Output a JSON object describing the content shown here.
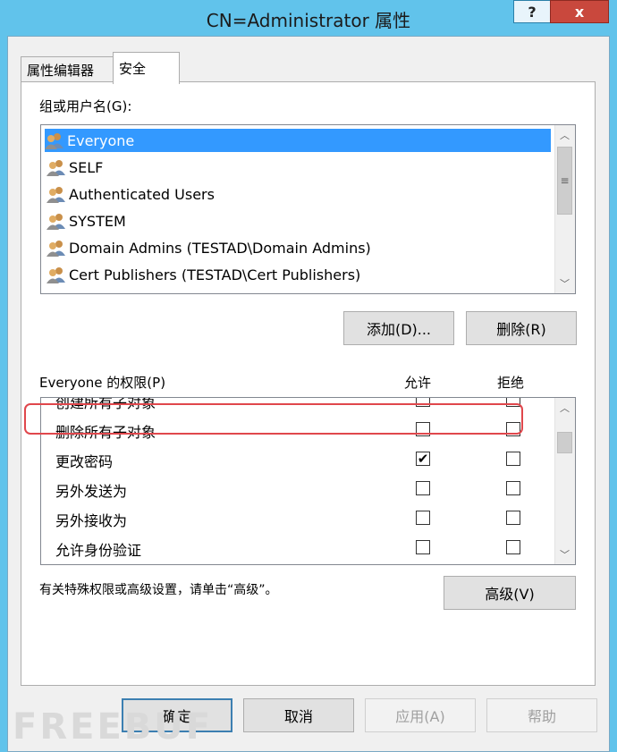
{
  "window": {
    "title": "CN=Administrator 属性",
    "help_label": "?",
    "close_label": "x"
  },
  "tabs": [
    {
      "label": "属性编辑器"
    },
    {
      "label": "安全"
    }
  ],
  "groups": {
    "label": "组或用户名(G):",
    "items": [
      {
        "label": "Everyone",
        "selected": true
      },
      {
        "label": "SELF"
      },
      {
        "label": "Authenticated Users"
      },
      {
        "label": "SYSTEM"
      },
      {
        "label": "Domain Admins (TESTAD\\Domain Admins)"
      },
      {
        "label": "Cert Publishers (TESTAD\\Cert Publishers)"
      }
    ],
    "add_button": "添加(D)...",
    "remove_button": "删除(R)"
  },
  "permissions": {
    "label": "Everyone 的权限(P)",
    "allow_header": "允许",
    "deny_header": "拒绝",
    "rows": [
      {
        "name": "创建所有子对象",
        "allow": false,
        "deny": false
      },
      {
        "name": "删除所有子对象",
        "allow": false,
        "deny": false
      },
      {
        "name": "更改密码",
        "allow": true,
        "deny": false
      },
      {
        "name": "另外发送为",
        "allow": false,
        "deny": false
      },
      {
        "name": "另外接收为",
        "allow": false,
        "deny": false
      },
      {
        "name": "允许身份验证",
        "allow": false,
        "deny": false
      }
    ],
    "check_glyph": "✔"
  },
  "advanced": {
    "hint": "有关特殊权限或高级设置，请单击“高级”。",
    "button": "高级(V)"
  },
  "footer": {
    "ok": "确定",
    "cancel": "取消",
    "apply": "应用(A)",
    "help": "帮助"
  },
  "watermark": "FREEBUF",
  "colors": {
    "frame": "#61c3eb",
    "selection": "#3399ff",
    "highlight": "#e0474c"
  }
}
